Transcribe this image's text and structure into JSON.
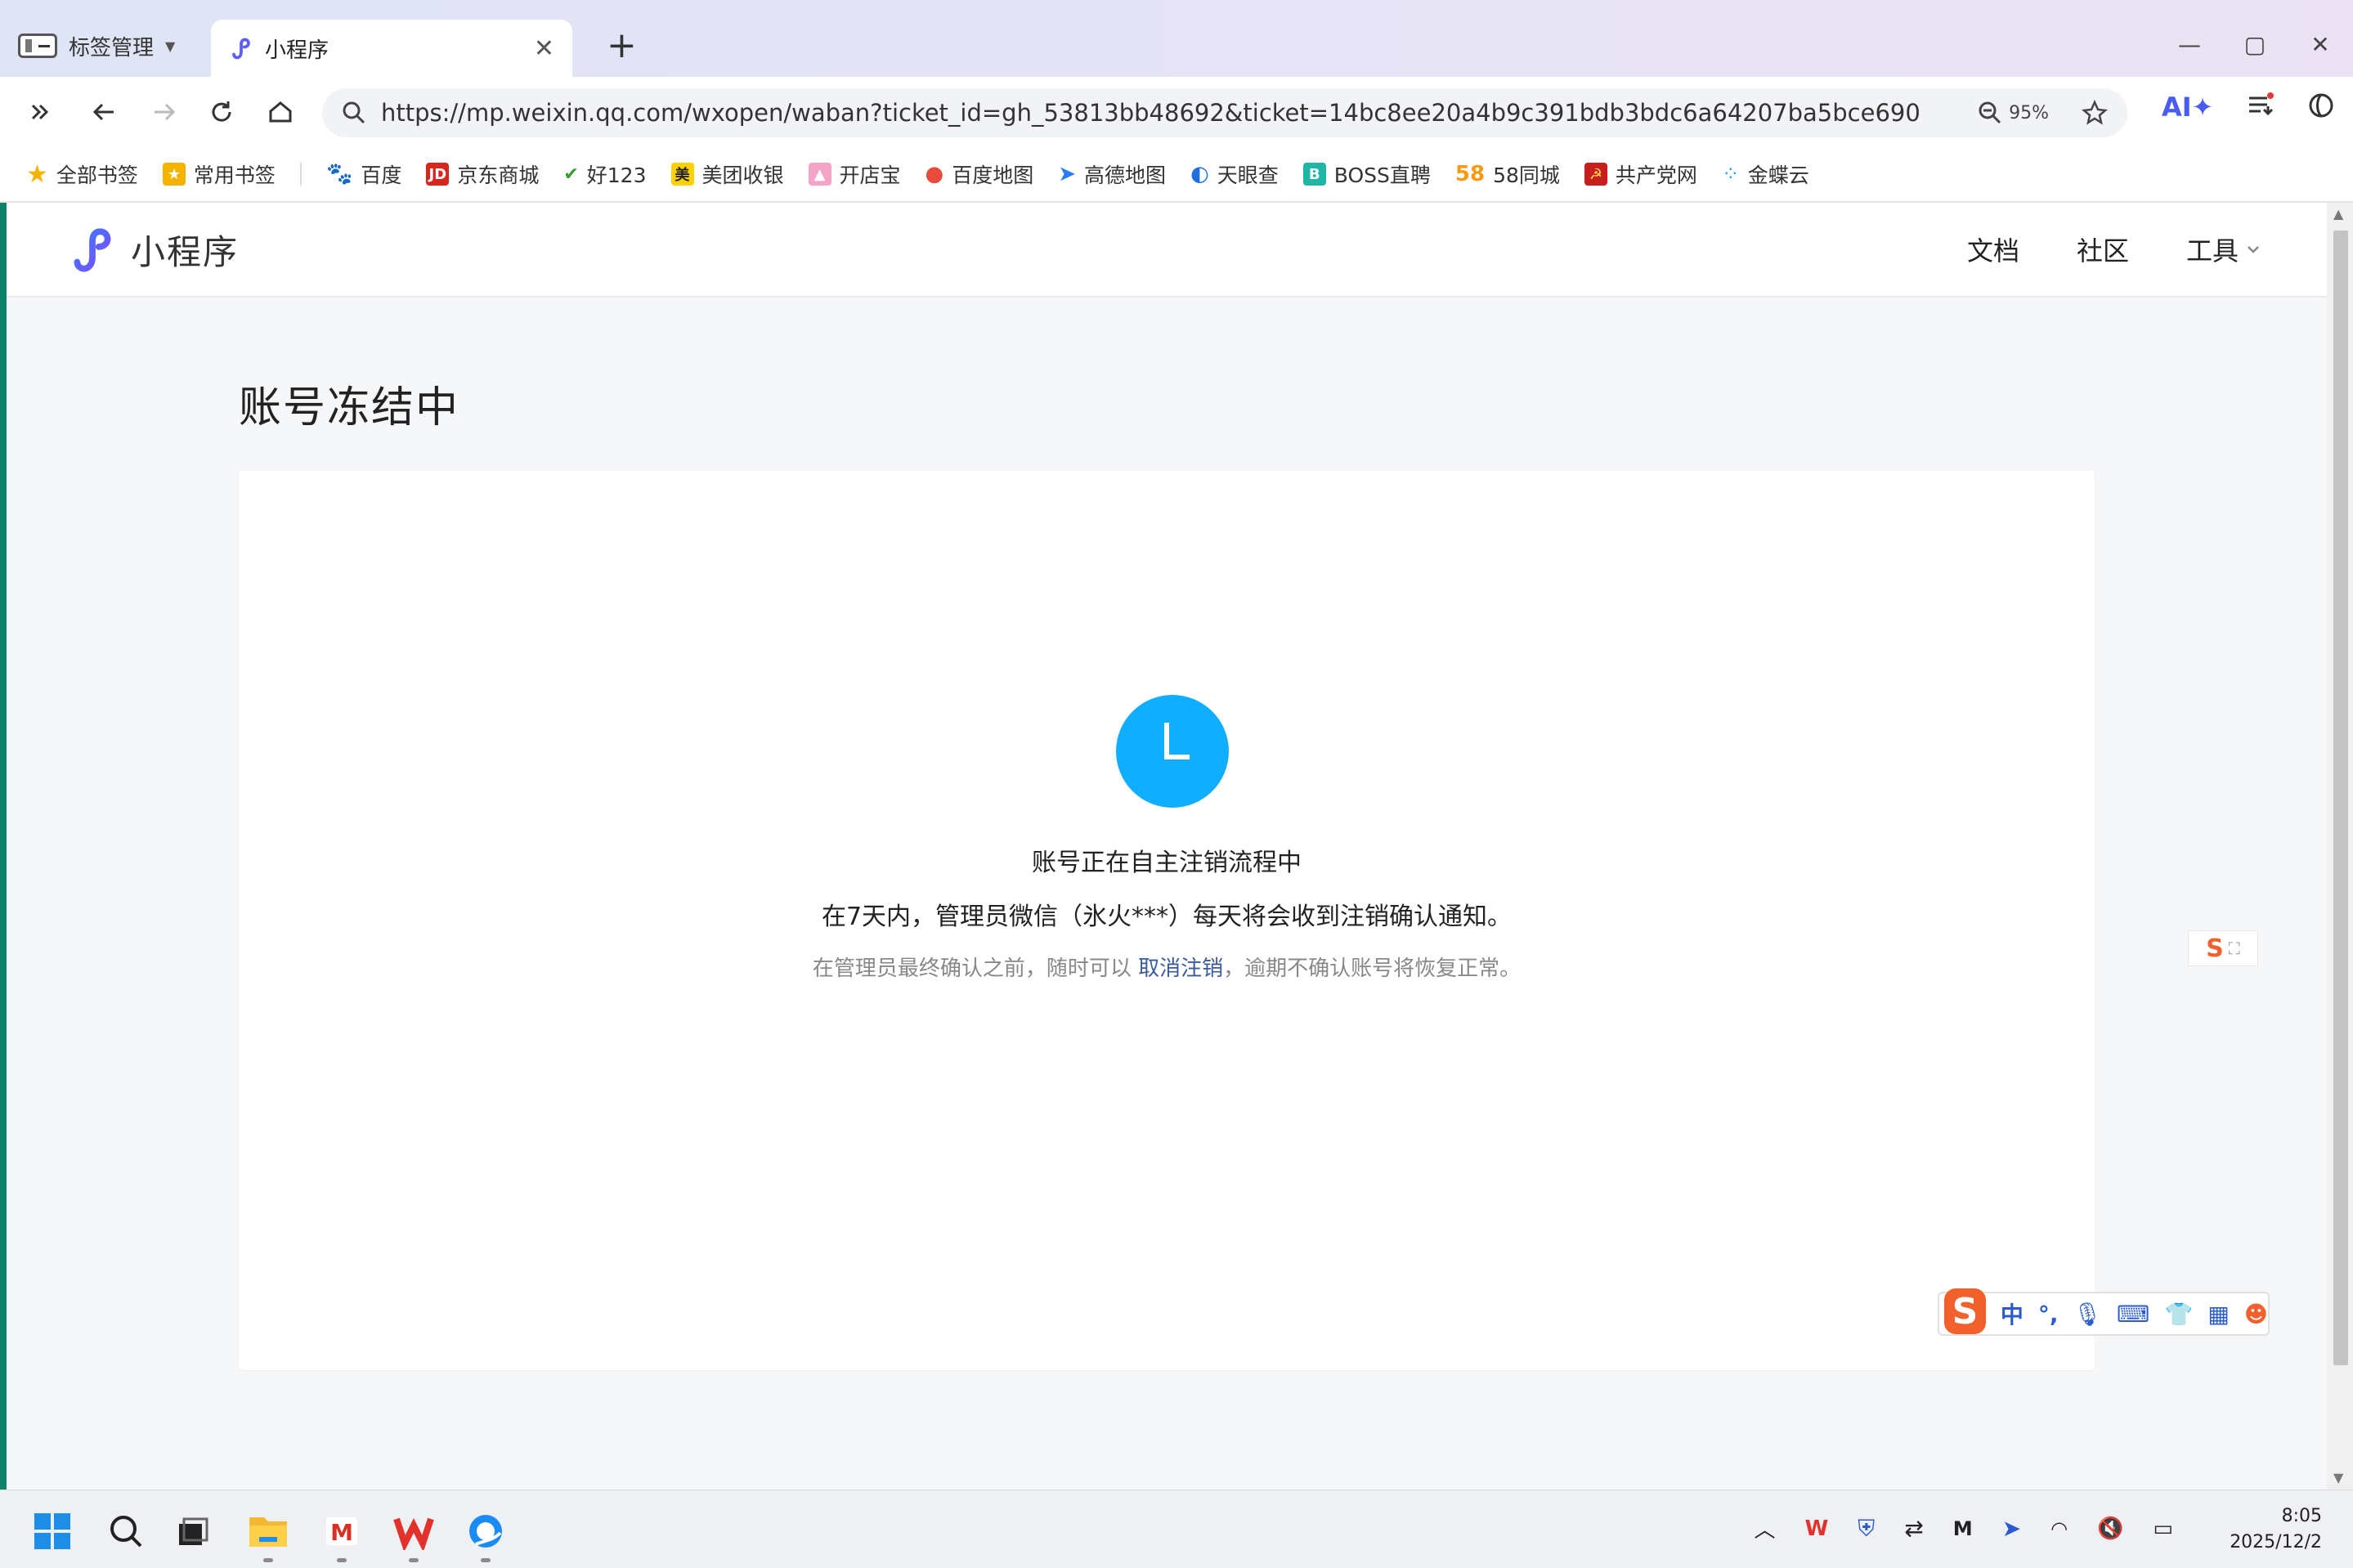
{
  "browser": {
    "tab_manage_label": "标签管理",
    "active_tab_label": "小程序",
    "url": "https://mp.weixin.qq.com/wxopen/waban?ticket_id=gh_53813bb48692&ticket=14bc8ee20a4b9c391bdb3bdc6a64207ba5bce690",
    "zoom": "95%",
    "ai_label": "AI✦"
  },
  "bookmarks": [
    {
      "label": "全部书签",
      "icon": "star-icon",
      "color": "#f5b301"
    },
    {
      "label": "常用书签",
      "icon": "bookmark-icon",
      "color": "#f5b301"
    },
    {
      "label": "百度",
      "icon": "baidu-icon",
      "color": "#2f55d4"
    },
    {
      "label": "京东商城",
      "icon": "jd-icon",
      "color": "#d9261c"
    },
    {
      "label": "好123",
      "icon": "hao123-icon",
      "color": "#3a9a2f"
    },
    {
      "label": "美团收银",
      "icon": "meituan-icon",
      "color": "#ffd100"
    },
    {
      "label": "开店宝",
      "icon": "kaidianbao-icon",
      "color": "#f5a3c7"
    },
    {
      "label": "百度地图",
      "icon": "map-pin-icon",
      "color": "#e84a3c"
    },
    {
      "label": "高德地图",
      "icon": "amap-icon",
      "color": "#2a7cf5"
    },
    {
      "label": "天眼查",
      "icon": "tianyancha-icon",
      "color": "#1f6fe0"
    },
    {
      "label": "BOSS直聘",
      "icon": "boss-icon",
      "color": "#1fb6a6"
    },
    {
      "label": "58同城",
      "icon": "58-icon",
      "color": "#f49a13"
    },
    {
      "label": "共产党网",
      "icon": "party-icon",
      "color": "#c81e1e"
    },
    {
      "label": "金蝶云",
      "icon": "kingdee-icon",
      "color": "#2fa7e6"
    }
  ],
  "site": {
    "logo_text": "小程序",
    "nav": {
      "docs": "文档",
      "community": "社区",
      "tools": "工具"
    }
  },
  "page": {
    "title": "账号冻结中",
    "status_main": "账号正在自主注销流程中",
    "status_sub": "在7天内，管理员微信（氷火***）每天将会收到注销确认通知。",
    "note_before": "在管理员最终确认之前，随时可以",
    "note_link": "取消注销",
    "note_after": "，逾期不确认账号将恢复正常。",
    "accent_color": "#10aeff"
  },
  "ime": {
    "lang": "中",
    "punct": "°,"
  },
  "taskbar": {
    "time": "8:05",
    "date": "2025/12/2"
  }
}
